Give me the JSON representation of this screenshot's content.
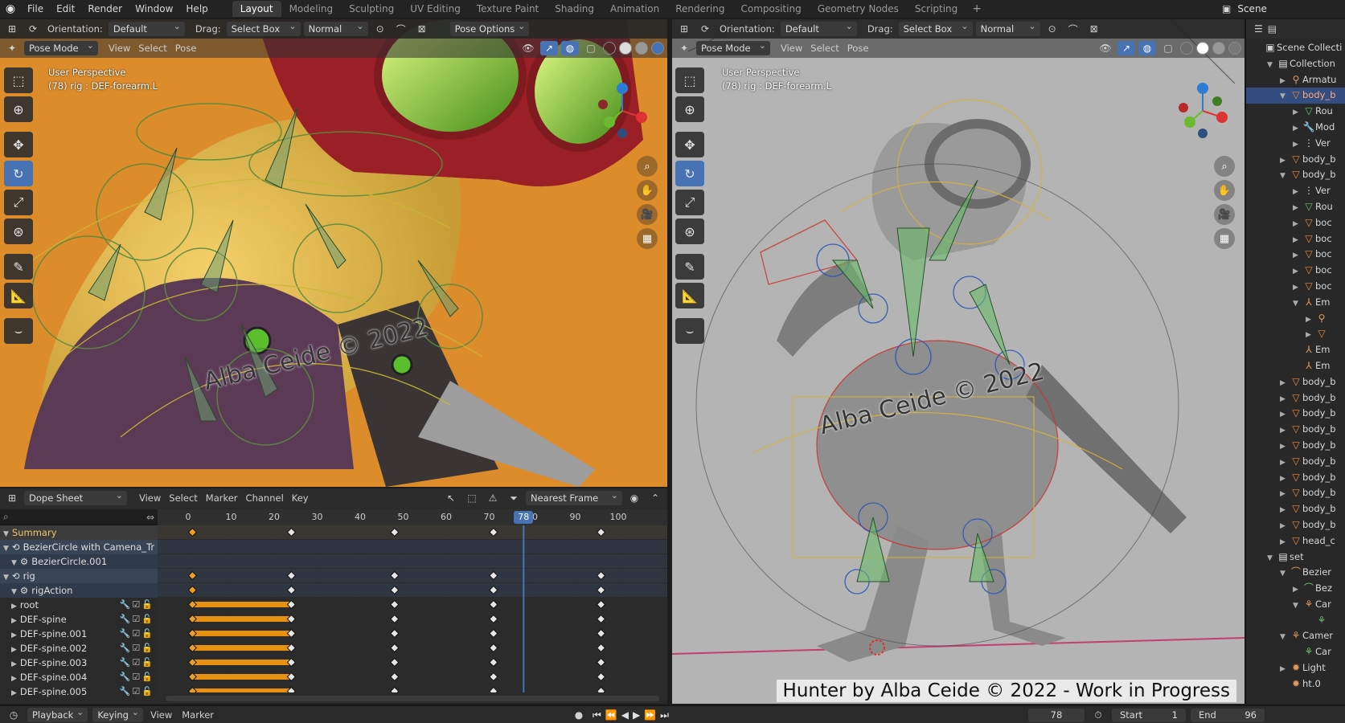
{
  "topbar": {
    "menus": [
      "File",
      "Edit",
      "Render",
      "Window",
      "Help"
    ],
    "workspaces": [
      "Layout",
      "Modeling",
      "Sculpting",
      "UV Editing",
      "Texture Paint",
      "Shading",
      "Animation",
      "Rendering",
      "Compositing",
      "Geometry Nodes",
      "Scripting"
    ],
    "active_workspace": "Layout",
    "scene": "Scene"
  },
  "viewport_left": {
    "orientation_label": "Orientation:",
    "orientation": "Default",
    "drag_label": "Drag:",
    "drag": "Select Box",
    "pivot": "Normal",
    "pose_options": "Pose Options",
    "mode": "Pose Mode",
    "menus": [
      "View",
      "Select",
      "Pose"
    ],
    "info_line1": "User Perspective",
    "info_line2": "(78) rig : DEF-forearm.L",
    "watermark": "Alba Ceide © 2022"
  },
  "viewport_right": {
    "orientation_label": "Orientation:",
    "orientation": "Default",
    "drag_label": "Drag:",
    "drag": "Select Box",
    "pivot": "Normal",
    "mode": "Pose Mode",
    "menus": [
      "View",
      "Select",
      "Pose"
    ],
    "info_line1": "User Perspective",
    "info_line2": "(78) rig : DEF-forearm.L",
    "watermark": "Alba Ceide © 2022",
    "credit": "Hunter by Alba Ceide © 2022 - Work in Progress"
  },
  "dopesheet": {
    "editor": "Dope Sheet",
    "menus": [
      "View",
      "Select",
      "Marker",
      "Channel",
      "Key"
    ],
    "snap": "Nearest Frame",
    "ruler_ticks": [
      0,
      10,
      20,
      30,
      40,
      50,
      60,
      70,
      80,
      90,
      100
    ],
    "current_frame": 78,
    "channels": [
      {
        "label": "Summary",
        "kind": "summary",
        "indent": 0
      },
      {
        "label": "BezierCircle with Camena_Tr",
        "kind": "obj",
        "indent": 0
      },
      {
        "label": "BezierCircle.001",
        "kind": "act",
        "indent": 1
      },
      {
        "label": "rig",
        "kind": "obj",
        "indent": 0
      },
      {
        "label": "rigAction",
        "kind": "act",
        "indent": 1
      },
      {
        "label": "root",
        "kind": "grp",
        "indent": 1
      },
      {
        "label": "DEF-spine",
        "kind": "grp",
        "indent": 1
      },
      {
        "label": "DEF-spine.001",
        "kind": "grp",
        "indent": 1
      },
      {
        "label": "DEF-spine.002",
        "kind": "grp",
        "indent": 1
      },
      {
        "label": "DEF-spine.003",
        "kind": "grp",
        "indent": 1
      },
      {
        "label": "DEF-spine.004",
        "kind": "grp",
        "indent": 1
      },
      {
        "label": "DEF-spine.005",
        "kind": "grp",
        "indent": 1
      }
    ],
    "key_frames": [
      1,
      24,
      48,
      71,
      96
    ],
    "key_rows": [
      0,
      3,
      4,
      5,
      6,
      7,
      8,
      9,
      10,
      11
    ],
    "hold_rows": [
      5,
      6,
      7,
      8,
      9,
      10,
      11
    ],
    "hold_range": [
      1,
      24
    ]
  },
  "outliner": {
    "rows": [
      {
        "label": "Scene Collecti",
        "icon": "scene-collection",
        "indent": 0,
        "arrow": ""
      },
      {
        "label": "Collection",
        "icon": "collection",
        "indent": 1,
        "arrow": "▼"
      },
      {
        "label": "Armatu",
        "icon": "armature",
        "indent": 2,
        "arrow": "▶"
      },
      {
        "label": "body_b",
        "icon": "mesh",
        "indent": 2,
        "arrow": "▼",
        "selected": true
      },
      {
        "label": "Rou",
        "icon": "vertex-group",
        "indent": 3,
        "arrow": "▶"
      },
      {
        "label": "Mod",
        "icon": "modifier",
        "indent": 3,
        "arrow": "▶"
      },
      {
        "label": "Ver",
        "icon": "vertex-data",
        "indent": 3,
        "arrow": "▶"
      },
      {
        "label": "body_b",
        "icon": "mesh",
        "indent": 2,
        "arrow": "▶"
      },
      {
        "label": "body_b",
        "icon": "mesh",
        "indent": 2,
        "arrow": "▼"
      },
      {
        "label": "Ver",
        "icon": "vertex-data",
        "indent": 3,
        "arrow": "▶"
      },
      {
        "label": "Rou",
        "icon": "vertex-group",
        "indent": 3,
        "arrow": "▶"
      },
      {
        "label": "boc",
        "icon": "mesh",
        "indent": 3,
        "arrow": "▶"
      },
      {
        "label": "boc",
        "icon": "mesh",
        "indent": 3,
        "arrow": "▶"
      },
      {
        "label": "boc",
        "icon": "mesh",
        "indent": 3,
        "arrow": "▶"
      },
      {
        "label": "boc",
        "icon": "mesh",
        "indent": 3,
        "arrow": "▶"
      },
      {
        "label": "boc",
        "icon": "mesh",
        "indent": 3,
        "arrow": "▶"
      },
      {
        "label": "Em",
        "icon": "empty",
        "indent": 3,
        "arrow": "▼"
      },
      {
        "label": "",
        "icon": "armature",
        "indent": 4,
        "arrow": "▶"
      },
      {
        "label": "",
        "icon": "mesh",
        "indent": 4,
        "arrow": "▶"
      },
      {
        "label": "Em",
        "icon": "empty",
        "indent": 3,
        "arrow": ""
      },
      {
        "label": "Em",
        "icon": "empty",
        "indent": 3,
        "arrow": ""
      },
      {
        "label": "body_b",
        "icon": "mesh",
        "indent": 2,
        "arrow": "▶"
      },
      {
        "label": "body_b",
        "icon": "mesh",
        "indent": 2,
        "arrow": "▶"
      },
      {
        "label": "body_b",
        "icon": "mesh",
        "indent": 2,
        "arrow": "▶"
      },
      {
        "label": "body_b",
        "icon": "mesh",
        "indent": 2,
        "arrow": "▶"
      },
      {
        "label": "body_b",
        "icon": "mesh",
        "indent": 2,
        "arrow": "▶"
      },
      {
        "label": "body_b",
        "icon": "mesh",
        "indent": 2,
        "arrow": "▶"
      },
      {
        "label": "body_b",
        "icon": "mesh",
        "indent": 2,
        "arrow": "▶"
      },
      {
        "label": "body_b",
        "icon": "mesh",
        "indent": 2,
        "arrow": "▶"
      },
      {
        "label": "body_b",
        "icon": "mesh",
        "indent": 2,
        "arrow": "▶"
      },
      {
        "label": "body_b",
        "icon": "mesh",
        "indent": 2,
        "arrow": "▶"
      },
      {
        "label": "head_c",
        "icon": "mesh",
        "indent": 2,
        "arrow": "▶"
      },
      {
        "label": "set",
        "icon": "collection",
        "indent": 1,
        "arrow": "▼"
      },
      {
        "label": "Bezier",
        "icon": "curve",
        "indent": 2,
        "arrow": "▼"
      },
      {
        "label": "Bez",
        "icon": "curve-data",
        "indent": 3,
        "arrow": "▶"
      },
      {
        "label": "Car",
        "icon": "camera-group",
        "indent": 3,
        "arrow": "▼"
      },
      {
        "label": "",
        "icon": "camera-data",
        "indent": 4,
        "arrow": ""
      },
      {
        "label": "Camer",
        "icon": "camera",
        "indent": 2,
        "arrow": "▼"
      },
      {
        "label": "Car",
        "icon": "camera-data",
        "indent": 3,
        "arrow": ""
      },
      {
        "label": "Light",
        "icon": "light",
        "indent": 2,
        "arrow": "▶"
      },
      {
        "label": "ht.0",
        "icon": "light",
        "indent": 2,
        "arrow": ""
      }
    ]
  },
  "timeline": {
    "playback": "Playback",
    "keying": "Keying",
    "menus": [
      "View",
      "Marker"
    ],
    "current_frame": "78",
    "start_label": "Start",
    "start": "1",
    "end_label": "End",
    "end": "96"
  },
  "colors": {
    "accent": "#4772b3",
    "keyframe": "#e6e6e6",
    "key_selected": "#f0a020",
    "hold_bar": "#e8900f",
    "playhead": "#4772b3",
    "summary_text": "#f3c56b"
  }
}
